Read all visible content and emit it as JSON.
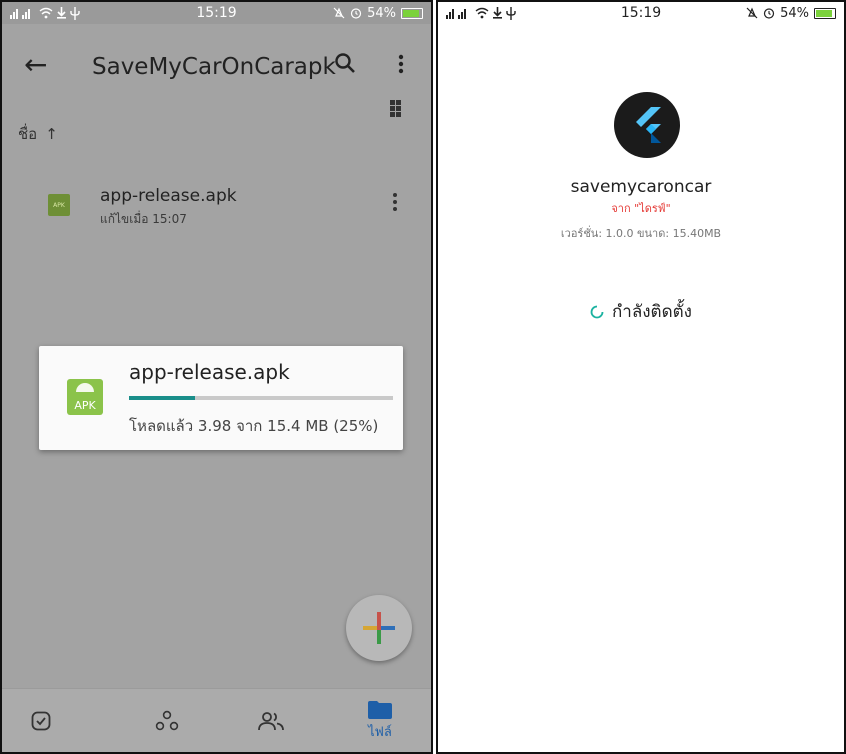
{
  "left": {
    "statusbar": {
      "time": "15:19",
      "battery": "54%"
    },
    "appbar": {
      "title": "SaveMyCarOnCarapk",
      "sort_label": "ชื่อ"
    },
    "file": {
      "name": "app-release.apk",
      "modified": "แก้ไขเมื่อ 15:07",
      "icon_text": "APK"
    },
    "dialog": {
      "title": "app-release.apk",
      "status": "โหลดแล้ว 3.98 จาก 15.4 MB (25%)",
      "progress_percent": 25,
      "icon_text": "APK"
    },
    "nav": {
      "files_label": "ไฟล์"
    },
    "colors": {
      "accent": "#1a8e8a",
      "nav_active": "#1e5fa8"
    }
  },
  "right": {
    "statusbar": {
      "time": "15:19",
      "battery": "54%"
    },
    "app_name": "savemycaroncar",
    "source": "จาก \"ไดรฟ์\"",
    "version": "เวอร์ชั่น: 1.0.0   ขนาด: 15.40MB",
    "installing": "กำลังติดตั้ง"
  }
}
